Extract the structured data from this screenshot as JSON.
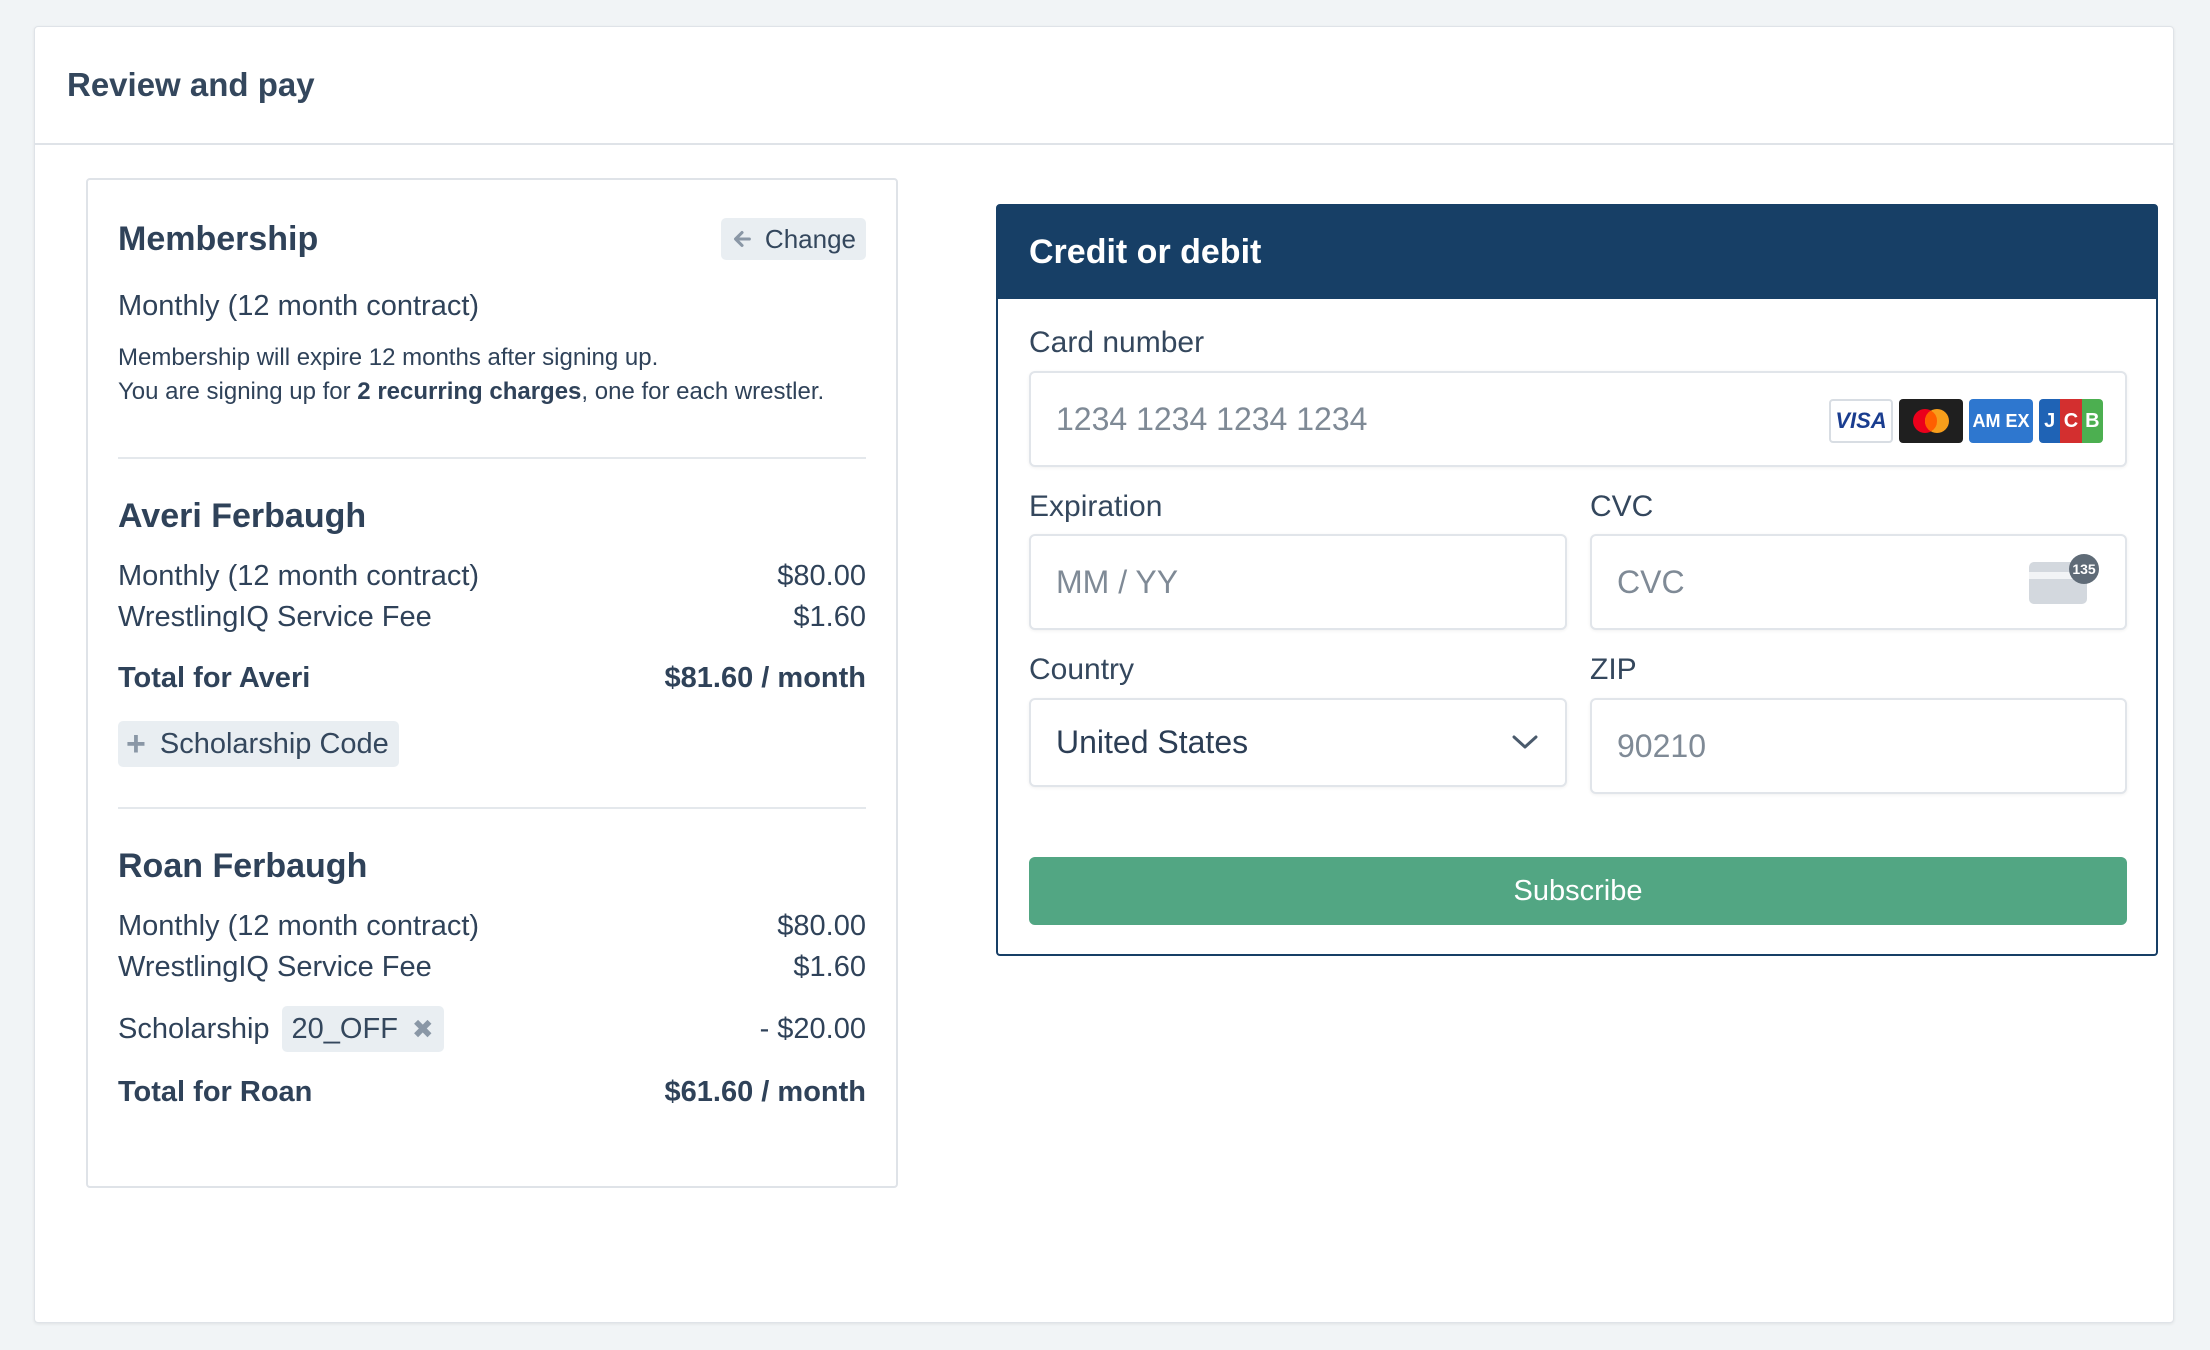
{
  "page": {
    "title": "Review and pay"
  },
  "membership": {
    "title": "Membership",
    "change_label": "Change",
    "plan": "Monthly (12 month contract)",
    "note_line1": "Membership will expire 12 months after signing up.",
    "note_prefix": "You are signing up for ",
    "note_bold": "2 recurring charges",
    "note_suffix": ", one for each wrestler."
  },
  "wrestlers": [
    {
      "name": "Averi Ferbaugh",
      "items": [
        {
          "label": "Monthly (12 month contract)",
          "amount": "$80.00"
        },
        {
          "label": "WrestlingIQ Service Fee",
          "amount": "$1.60"
        }
      ],
      "total_label": "Total for Averi",
      "total_amount": "$81.60 / month",
      "scholarship_button": "Scholarship Code"
    },
    {
      "name": "Roan Ferbaugh",
      "items": [
        {
          "label": "Monthly (12 month contract)",
          "amount": "$80.00"
        },
        {
          "label": "WrestlingIQ Service Fee",
          "amount": "$1.60"
        }
      ],
      "scholarship_label": "Scholarship",
      "scholarship_code": "20_OFF",
      "scholarship_amount": "- $20.00",
      "total_label": "Total for Roan",
      "total_amount": "$61.60 / month"
    }
  ],
  "payment": {
    "title": "Credit or debit",
    "card_number_label": "Card number",
    "card_number_placeholder": "1234 1234 1234 1234",
    "expiration_label": "Expiration",
    "expiration_placeholder": "MM / YY",
    "cvc_label": "CVC",
    "cvc_placeholder": "CVC",
    "cvc_icon_text": "135",
    "country_label": "Country",
    "country_value": "United States",
    "zip_label": "ZIP",
    "zip_placeholder": "90210",
    "subscribe_label": "Subscribe",
    "brands": {
      "visa": "VISA",
      "amex": "AM EX",
      "jcb": [
        "J",
        "C",
        "B"
      ]
    }
  },
  "colors": {
    "header_navy": "#173f66",
    "subscribe_green": "#52a683",
    "text": "#2f4259",
    "chip_bg": "#e9eef2"
  }
}
